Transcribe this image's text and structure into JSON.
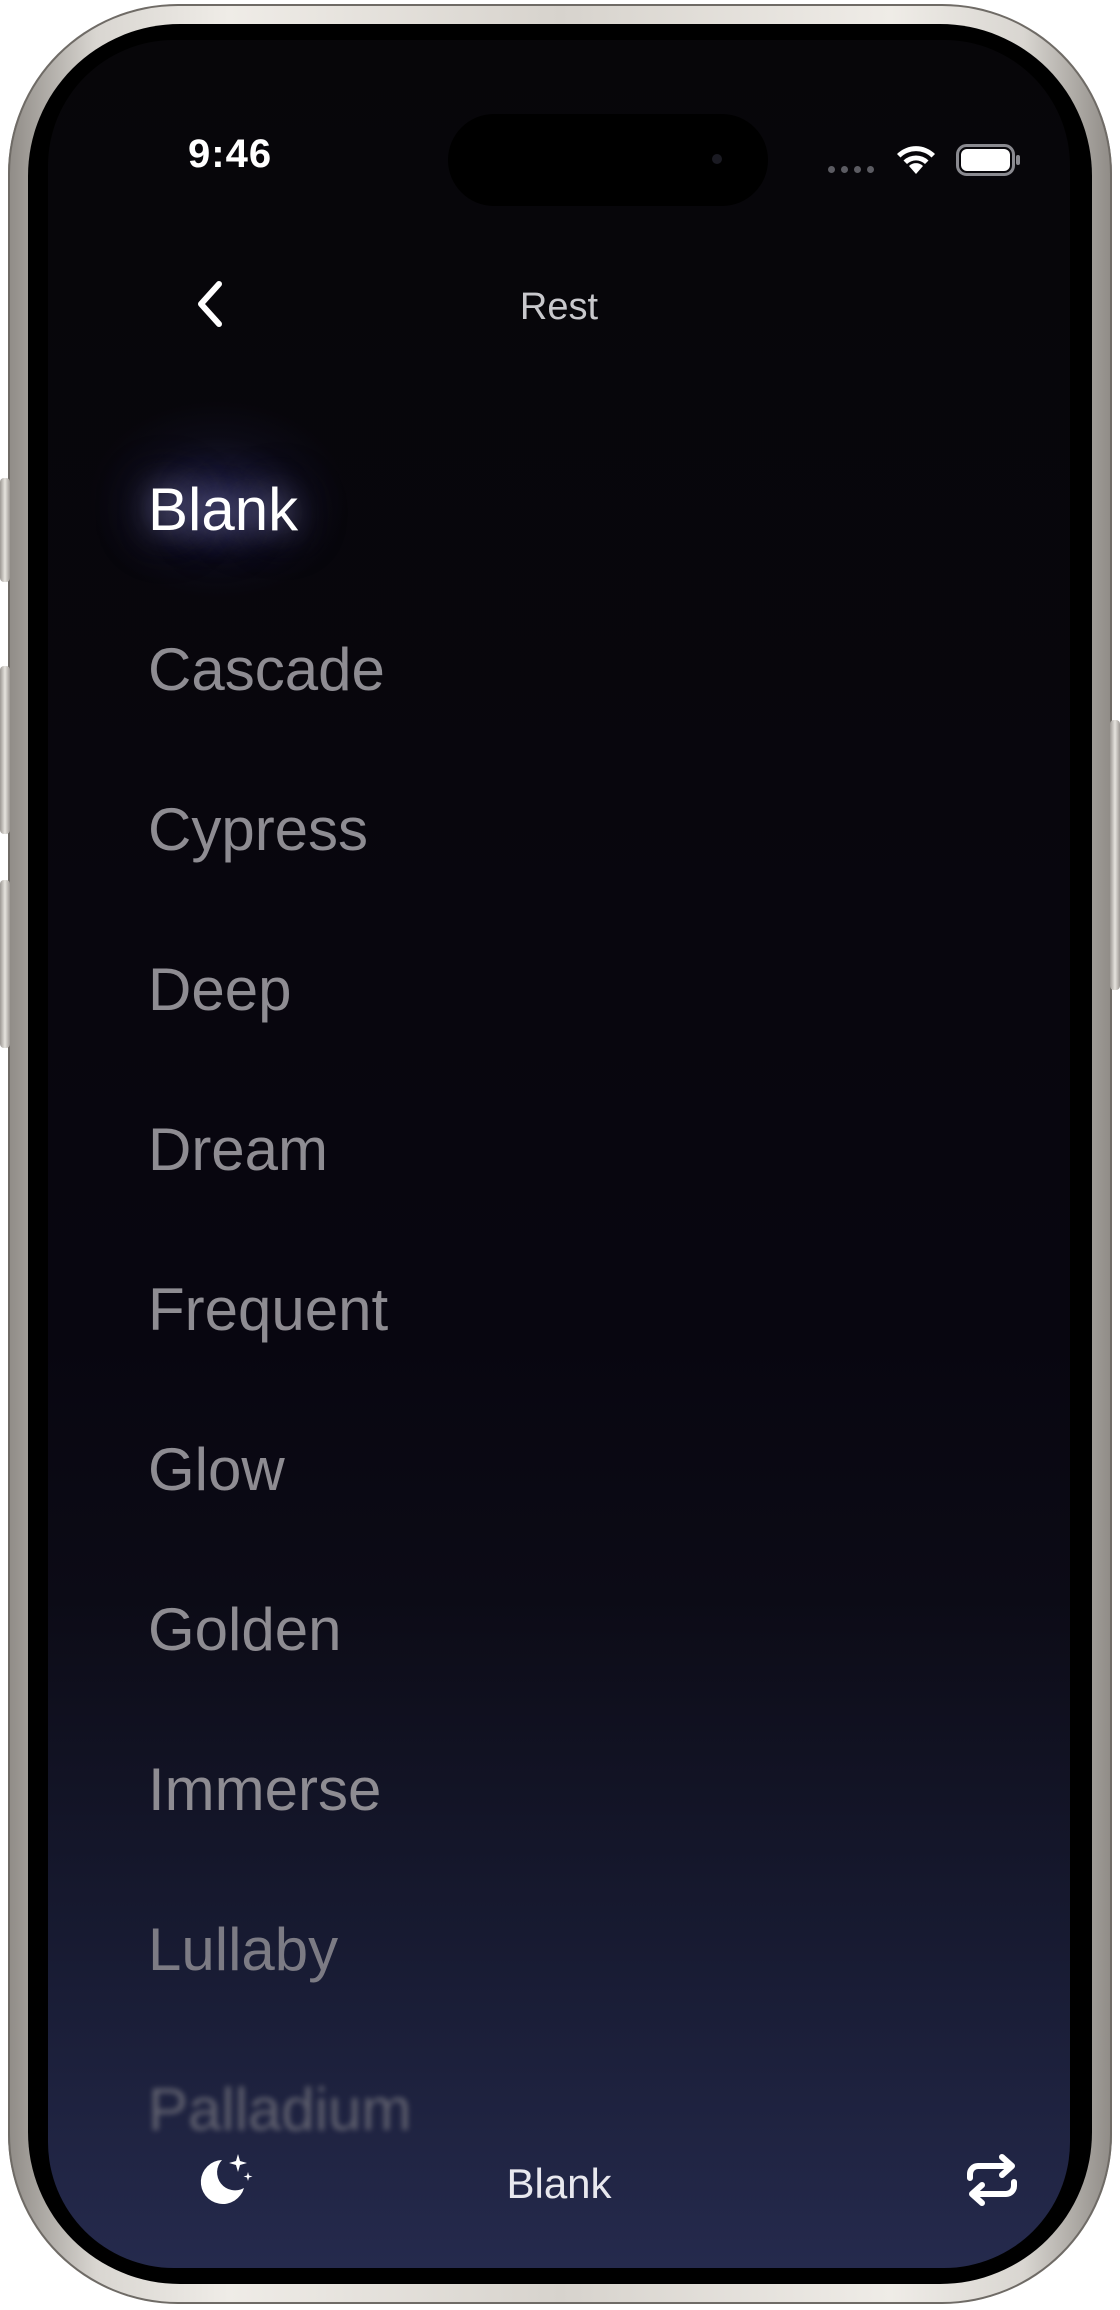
{
  "status_bar": {
    "time": "9:46",
    "icons": [
      "signal-dots-icon",
      "wifi-icon",
      "battery-icon"
    ]
  },
  "header": {
    "back_icon": "chevron-left-icon",
    "title": "Rest"
  },
  "sound_list": {
    "items": [
      {
        "label": "Blank",
        "selected": true
      },
      {
        "label": "Cascade",
        "selected": false
      },
      {
        "label": "Cypress",
        "selected": false
      },
      {
        "label": "Deep",
        "selected": false
      },
      {
        "label": "Dream",
        "selected": false
      },
      {
        "label": "Frequent",
        "selected": false
      },
      {
        "label": "Glow",
        "selected": false
      },
      {
        "label": "Golden",
        "selected": false
      },
      {
        "label": "Immerse",
        "selected": false
      },
      {
        "label": "Lullaby",
        "selected": false
      },
      {
        "label": "Palladium",
        "selected": false
      }
    ]
  },
  "bottom_bar": {
    "left_icon": "moon-stars-icon",
    "now_playing": "Blank",
    "right_icon": "repeat-icon"
  },
  "colors": {
    "background_top": "#070609",
    "background_bottom": "#252a4d",
    "selected_text": "#ffffff",
    "item_text": "#8e8c92"
  }
}
